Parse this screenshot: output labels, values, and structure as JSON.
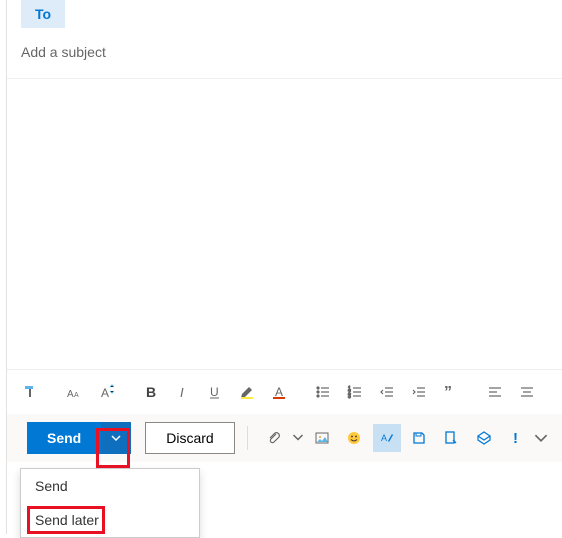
{
  "compose": {
    "to_label": "To",
    "subject_placeholder": "Add a subject",
    "subject_value": ""
  },
  "actions": {
    "send_label": "Send",
    "discard_label": "Discard"
  },
  "send_menu": {
    "items": [
      {
        "label": "Send"
      },
      {
        "label": "Send later"
      }
    ]
  },
  "colors": {
    "primary": "#0078d4",
    "highlight": "#e81123"
  }
}
